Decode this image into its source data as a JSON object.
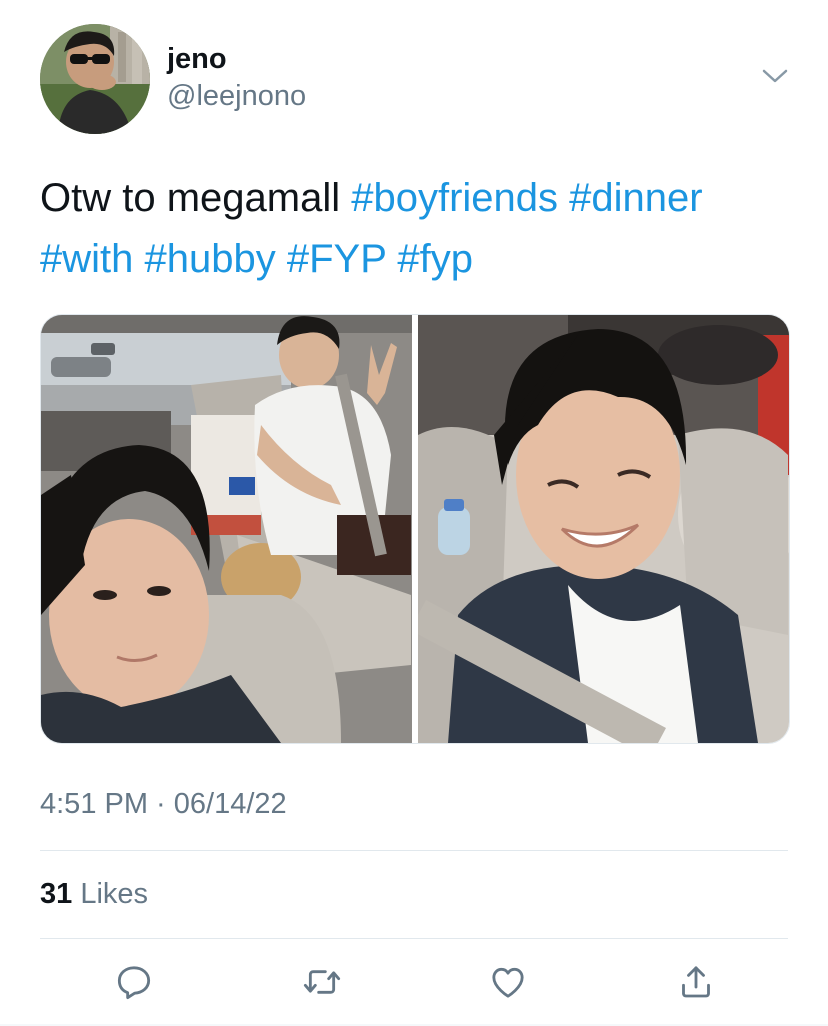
{
  "author": {
    "display_name": "jeno",
    "handle": "@leejnono",
    "avatar_icon": "profile-photo"
  },
  "tweet": {
    "text_plain": "Otw to megamall ",
    "hashtags": [
      "#boyfriends",
      "#dinner",
      "#with",
      "#hubby",
      "#FYP",
      "#fyp"
    ],
    "timestamp": "4:51 PM · 06/14/22"
  },
  "media": {
    "count": 2,
    "photos": [
      {
        "icon": "selfie-photo-backseat"
      },
      {
        "icon": "selfie-photo-smiling"
      }
    ]
  },
  "stats": {
    "likes_count": "31",
    "likes_label": "Likes"
  },
  "actions": {
    "reply_icon": "reply-icon",
    "retweet_icon": "retweet-icon",
    "like_icon": "heart-icon",
    "share_icon": "share-icon"
  },
  "colors": {
    "hashtag": "#1b95e0",
    "text": "#0f1419",
    "secondary": "#657786",
    "divider": "#e1e8ed",
    "icon": "#657786"
  }
}
